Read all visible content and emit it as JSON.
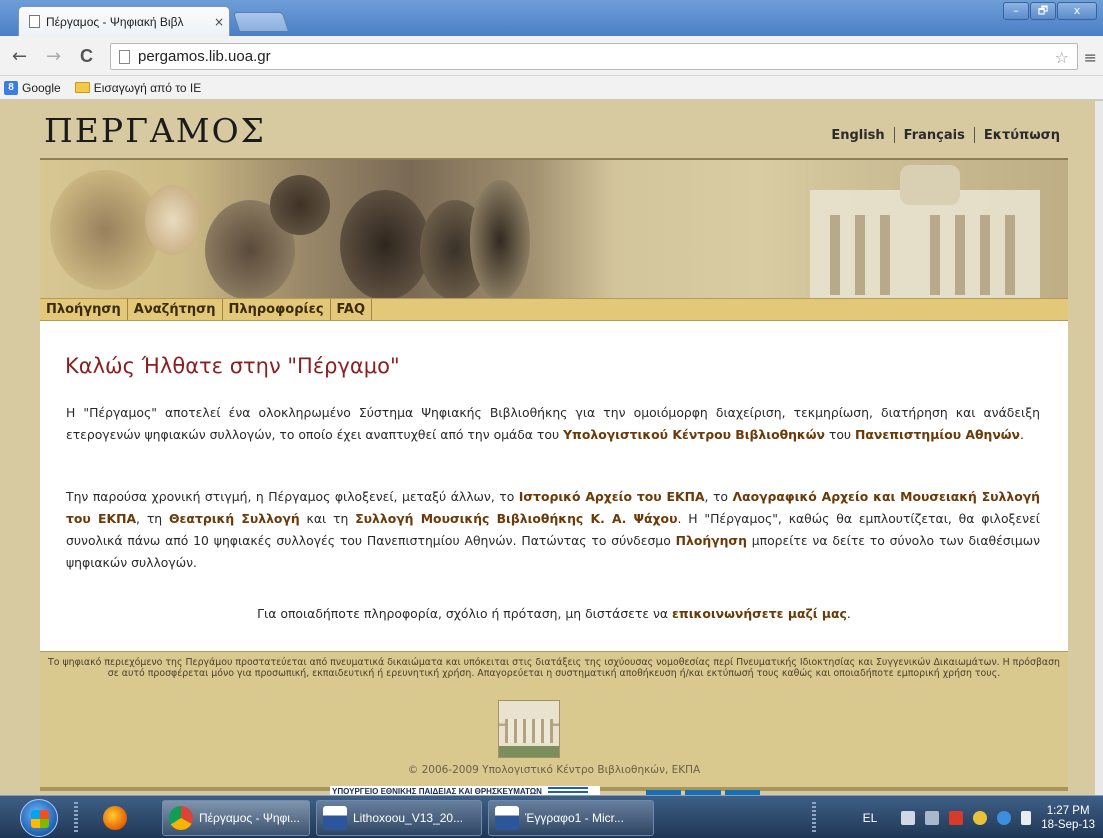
{
  "browser": {
    "tab_title": "Πέργαμος - Ψηφιακή Βιβλ",
    "tab_close": "×",
    "url": "pergamos.lib.uoa.gr",
    "back": "←",
    "forward": "→",
    "reload": "C",
    "star": "☆",
    "menu": "≡",
    "min": "–",
    "max": "🗗",
    "close": "x",
    "bookmarks": [
      {
        "label": "Google",
        "icon": "google-icon"
      },
      {
        "label": "Εισαγωγή από το IE",
        "icon": "folder-icon"
      }
    ]
  },
  "site": {
    "logo": "ΠΕΡΓΑΜΟΣ",
    "languages": [
      "English",
      "Français",
      "Εκτύπωση"
    ],
    "nav": [
      "Πλοήγηση",
      "Αναζήτηση",
      "Πληροφορίες",
      "FAQ"
    ],
    "welcome_title": "Καλώς Ήλθατε στην \"Πέργαμο\"",
    "p1": {
      "t1": "Η \"Πέργαμος\" αποτελεί ένα ολοκληρωμένο Σύστημα Ψηφιακής Βιβλιοθήκης για την ομοιόμορφη διαχείριση, τεκμηρίωση, διατήρηση και ανάδειξη ετερογενών ψηφιακών συλλογών, το οποίο έχει αναπτυχθεί από την ομάδα του ",
      "b1": "Υπολογιστικού Κέντρου Βιβλιοθηκών",
      "t2": " του ",
      "b2": "Πανεπιστημίου Αθηνών",
      "t3": "."
    },
    "p2": {
      "t1": "Την παρούσα χρονική στιγμή, η Πέργαμος φιλοξενεί, μεταξύ άλλων, το ",
      "b1": "Ιστορικό Αρχείο του ΕΚΠΑ",
      "t2": ", το ",
      "b2": "Λαογραφικό Αρχείο και Μουσειακή Συλλογή του ΕΚΠΑ",
      "t3": ", τη ",
      "b3": "Θεατρική Συλλογή",
      "t4": " και τη ",
      "b4": "Συλλογή Μουσικής Βιβλιοθήκης Κ. Α. Ψάχου",
      "t5": ". Η \"Πέργαμος\", καθώς θα εμπλουτίζεται, θα φιλοξενεί συνολικά πάνω από 10 ψηφιακές συλλογές του Πανεπιστημίου Αθηνών. Πατώντας το σύνδεσμο ",
      "b5": "Πλοήγηση",
      "t6": " μπορείτε να δείτε το σύνολο των διαθέσιμων ψηφιακών συλλογών."
    },
    "p3": {
      "t1": "Για οποιαδήποτε πληροφορία, σχόλιο ή πρόταση, μη διστάσετε να ",
      "b1": "επικοινωνήσετε μαζί μας",
      "t2": "."
    },
    "footer_text": "Το ψηφιακό περιεχόμενο της Περγάμου προστατεύεται από πνευματικά δικαιώματα και υπόκειται στις διατάξεις της ισχύουσας νομοθεσίας περί Πνευματικής Ιδιοκτησίας και Συγγενικών Δικαιωμάτων. Η πρόσβαση σε αυτό προσφέρεται μόνο για προσωπική, εκπαιδευτική ή ερευνητική χρήση. Απαγορεύεται η συστηματική αποθήκευση ή/και εκτύπωσή τους καθώς και οποιαδήποτε εμπορική χρήση τους.",
    "copyright": "© 2006-2009 Υπολογιστικό Κέντρο Βιβλιοθηκών, ΕΚΠΑ",
    "ministry_banner": "ΥΠΟΥΡΓΕΙΟ ΕΘΝΙΚΗΣ ΠΑΙΔΕΙΑΣ ΚΑΙ ΘΡΗΣΚΕΥΜΑΤΩΝ"
  },
  "taskbar": {
    "items": [
      {
        "label": "Πέργαμος - Ψηφι...",
        "icon": "chrome-icon"
      },
      {
        "label": "Lithoxoou_V13_20...",
        "icon": "word-icon"
      },
      {
        "label": "Έγγραφο1 - Micr...",
        "icon": "word-icon"
      }
    ],
    "language": "EL",
    "time": "1:27 PM",
    "date": "18-Sep-13"
  }
}
